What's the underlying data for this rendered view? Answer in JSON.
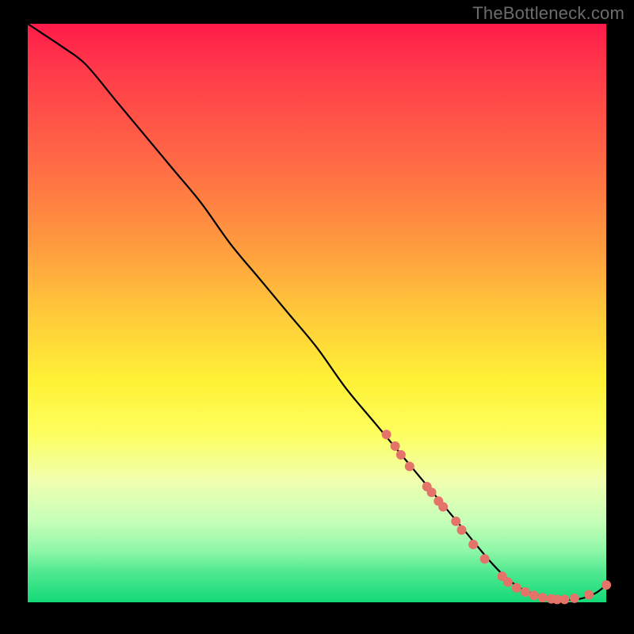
{
  "watermark": "TheBottleneck.com",
  "chart_data": {
    "type": "line",
    "title": "",
    "xlabel": "",
    "ylabel": "",
    "xlim": [
      0,
      100
    ],
    "ylim": [
      0,
      100
    ],
    "grid": false,
    "legend": false,
    "series": [
      {
        "name": "curve",
        "color": "#000000",
        "x": [
          0,
          3,
          6,
          10,
          15,
          20,
          25,
          30,
          35,
          40,
          45,
          50,
          55,
          60,
          65,
          70,
          75,
          80,
          83,
          86,
          89,
          92,
          95,
          98,
          100
        ],
        "y": [
          100,
          98,
          96,
          93,
          87,
          81,
          75,
          69,
          62,
          56,
          50,
          44,
          37,
          31,
          25,
          19,
          13,
          7,
          4,
          2,
          1,
          0.5,
          0.5,
          1.5,
          3
        ]
      }
    ],
    "markers": [
      {
        "name": "dots",
        "color": "#e4736a",
        "radius": 6,
        "points": [
          {
            "x": 62,
            "y": 29
          },
          {
            "x": 63.5,
            "y": 27
          },
          {
            "x": 64.5,
            "y": 25.5
          },
          {
            "x": 66,
            "y": 23.5
          },
          {
            "x": 69,
            "y": 20
          },
          {
            "x": 69.8,
            "y": 19
          },
          {
            "x": 71,
            "y": 17.5
          },
          {
            "x": 71.8,
            "y": 16.5
          },
          {
            "x": 74,
            "y": 14
          },
          {
            "x": 75,
            "y": 12.5
          },
          {
            "x": 77,
            "y": 10
          },
          {
            "x": 79,
            "y": 7.5
          },
          {
            "x": 82,
            "y": 4.5
          },
          {
            "x": 83,
            "y": 3.5
          },
          {
            "x": 84.5,
            "y": 2.5
          },
          {
            "x": 86,
            "y": 1.8
          },
          {
            "x": 87.5,
            "y": 1.2
          },
          {
            "x": 89,
            "y": 0.8
          },
          {
            "x": 90.5,
            "y": 0.6
          },
          {
            "x": 91.5,
            "y": 0.5
          },
          {
            "x": 92.8,
            "y": 0.5
          },
          {
            "x": 94.5,
            "y": 0.7
          },
          {
            "x": 97,
            "y": 1.3
          },
          {
            "x": 100,
            "y": 3
          }
        ]
      }
    ]
  }
}
